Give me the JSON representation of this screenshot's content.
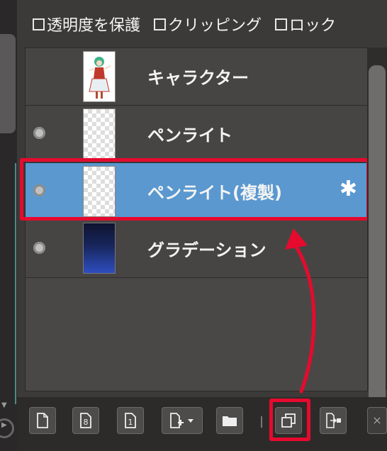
{
  "options": {
    "protect_alpha": "透明度を保護",
    "clipping": "クリッピング",
    "lock": "ロック"
  },
  "layers": [
    {
      "name": "キャラクター",
      "visible": false,
      "selected": false
    },
    {
      "name": "ペンライト",
      "visible": true,
      "selected": false
    },
    {
      "name": "ペンライト(複製)",
      "visible": true,
      "selected": true
    },
    {
      "name": "グラデーション",
      "visible": true,
      "selected": false
    }
  ],
  "colors": {
    "selected_layer": "#5a98cf",
    "highlight": "#e60a2e",
    "panel_bg": "#3c3a39"
  },
  "toolbar": {
    "buttons": [
      {
        "icon": "new-layer-icon"
      },
      {
        "icon": "new-8bit-layer-icon",
        "label": "8"
      },
      {
        "icon": "new-1bit-layer-icon",
        "label": "1"
      },
      {
        "icon": "add-layer-dropdown-icon"
      },
      {
        "icon": "folder-icon"
      },
      {
        "icon": "duplicate-layer-icon"
      },
      {
        "icon": "merge-down-icon"
      },
      {
        "icon": "close-icon"
      }
    ]
  }
}
